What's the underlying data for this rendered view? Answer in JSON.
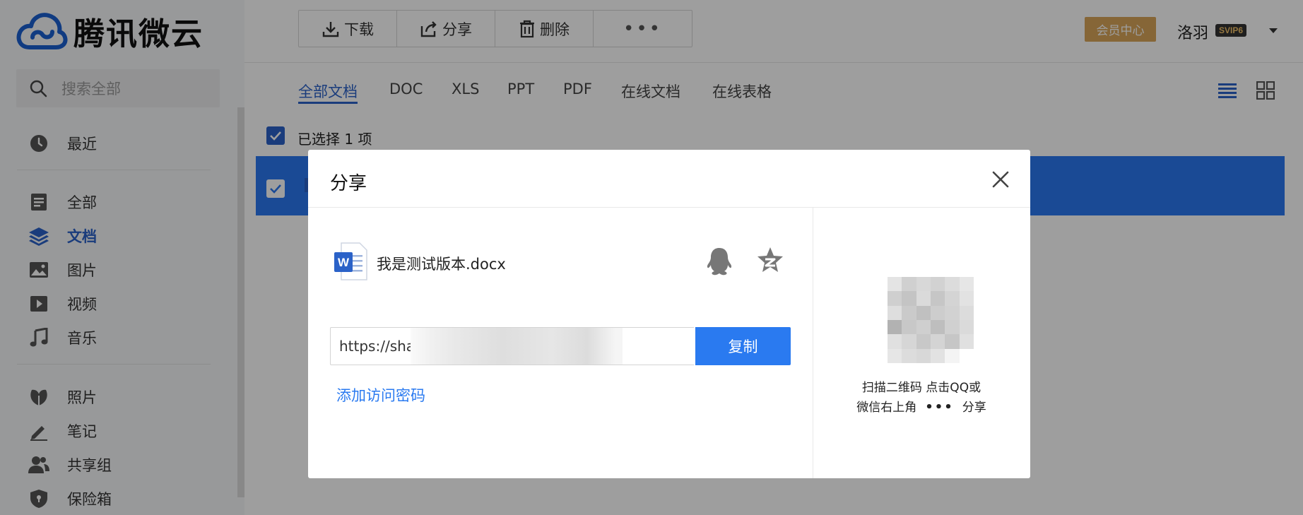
{
  "app": {
    "logo_text": "腾讯微云"
  },
  "search": {
    "placeholder": "搜索全部"
  },
  "sidebar": {
    "items": [
      {
        "key": "recent",
        "label": "最近",
        "icon": "clock-icon"
      },
      {
        "key": "all",
        "label": "全部",
        "icon": "file-icon"
      },
      {
        "key": "docs",
        "label": "文档",
        "icon": "layers-icon",
        "active": true
      },
      {
        "key": "images",
        "label": "图片",
        "icon": "image-icon"
      },
      {
        "key": "videos",
        "label": "视频",
        "icon": "play-icon"
      },
      {
        "key": "music",
        "label": "音乐",
        "icon": "music-note-icon"
      },
      {
        "key": "photos",
        "label": "照片",
        "icon": "leaf-icon"
      },
      {
        "key": "notes",
        "label": "笔记",
        "icon": "pen-icon"
      },
      {
        "key": "shared",
        "label": "共享组",
        "icon": "users-icon"
      },
      {
        "key": "vault",
        "label": "保险箱",
        "icon": "shield-icon"
      }
    ]
  },
  "toolbar": {
    "download_label": "下载",
    "share_label": "分享",
    "delete_label": "删除",
    "more_label": "•••"
  },
  "header": {
    "member_center": "会员中心",
    "user_name": "洛羽",
    "vip_badge": "SVIP6"
  },
  "tabs": [
    "全部文档",
    "DOC",
    "XLS",
    "PPT",
    "PDF",
    "在线文档",
    "在线表格"
  ],
  "selection": {
    "text": "已选择 1 项"
  },
  "share_dialog": {
    "title": "分享",
    "file_name": "我是测试版本.docx",
    "link_prefix": "https://sha",
    "copy_label": "复制",
    "add_password_label": "添加访问密码",
    "qr_hint_line1": "扫描二维码 点击QQ或",
    "qr_hint_line2_pre": "微信右上角",
    "qr_hint_dots": "•••",
    "qr_hint_line2_post": "分享"
  },
  "colors": {
    "accent": "#2b62c8",
    "primary_button": "#2a7af0",
    "member_gold": "#d8a55a",
    "selected_row": "#2a78f0"
  }
}
